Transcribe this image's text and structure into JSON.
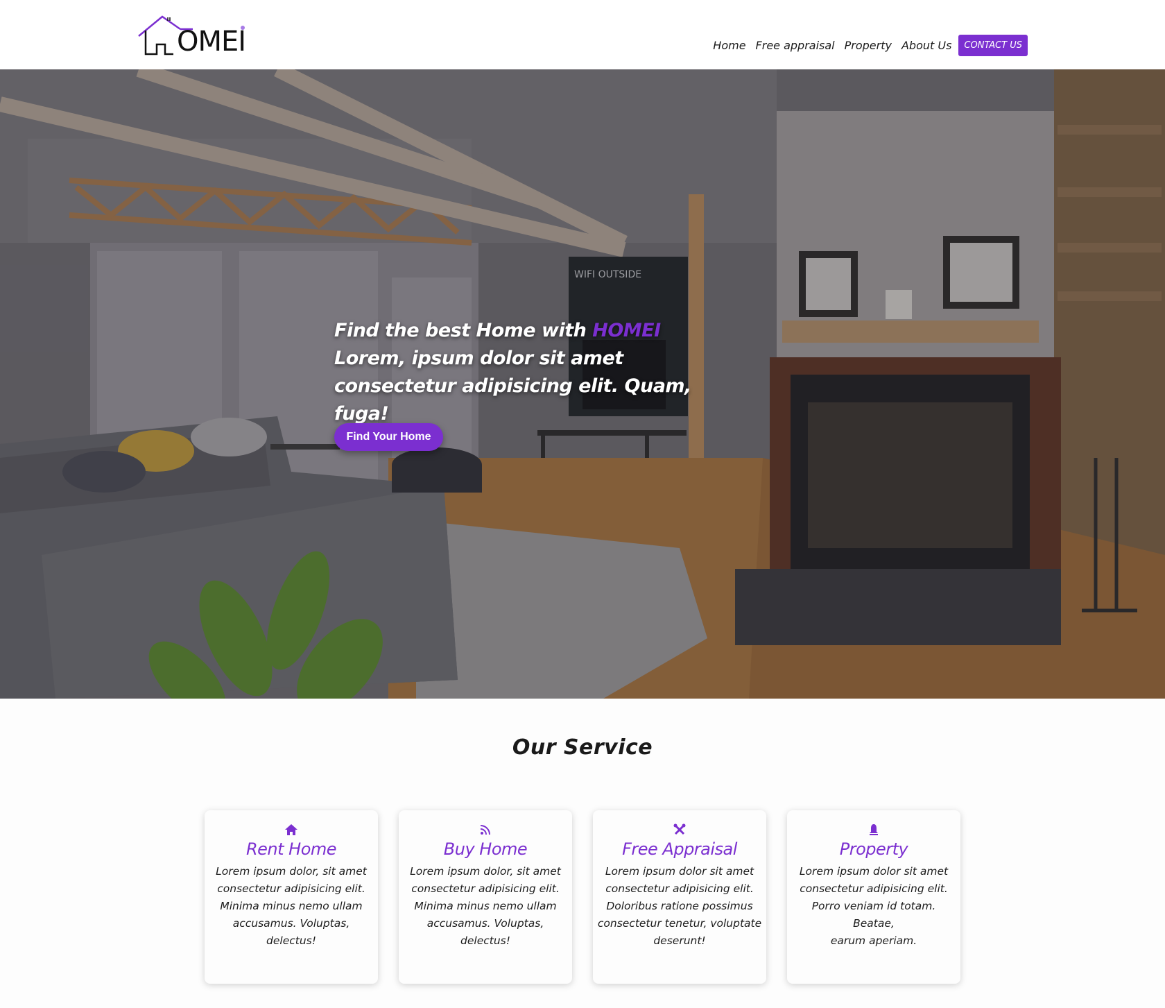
{
  "brand": {
    "logo_text": "OMEI",
    "accent_color": "#7b2fd0"
  },
  "nav": {
    "links": [
      "Home",
      "Free appraisal",
      "Property",
      "About Us"
    ],
    "contact_label": "CONTACT US"
  },
  "hero": {
    "headline_prefix": "Find the best Home with ",
    "headline_brand": "HOMEI",
    "subline_1": "Lorem, ipsum dolor sit amet",
    "subline_2": "consectetur adipisicing elit. Quam, fuga!",
    "cta_label": "Find Your Home",
    "tv_text": "WIFI OUTSIDE"
  },
  "services": {
    "title": "Our Service",
    "cards": [
      {
        "icon": "home-icon",
        "title": "Rent Home",
        "lines": [
          "Lorem ipsum dolor, sit amet",
          "consectetur adipisicing elit.",
          "Minima minus nemo ullam",
          "accusamus. Voluptas,",
          "delectus!"
        ]
      },
      {
        "icon": "rss-icon",
        "title": "Buy Home",
        "lines": [
          "Lorem ipsum dolor, sit amet",
          "consectetur adipisicing elit.",
          "Minima minus nemo ullam",
          "accusamus. Voluptas,",
          "delectus!"
        ]
      },
      {
        "icon": "tools-icon",
        "title": "Free Appraisal",
        "lines": [
          "Lorem ipsum dolor sit amet",
          "consectetur adipisicing elit.",
          "Doloribus ratione possimus",
          "consectetur tenetur, voluptate",
          "deserunt!"
        ]
      },
      {
        "icon": "bell-icon",
        "title": "Property",
        "lines": [
          "Lorem ipsum dolor sit amet",
          "consectetur adipisicing elit.",
          "Porro veniam id totam. Beatae,",
          "earum aperiam."
        ]
      }
    ]
  }
}
